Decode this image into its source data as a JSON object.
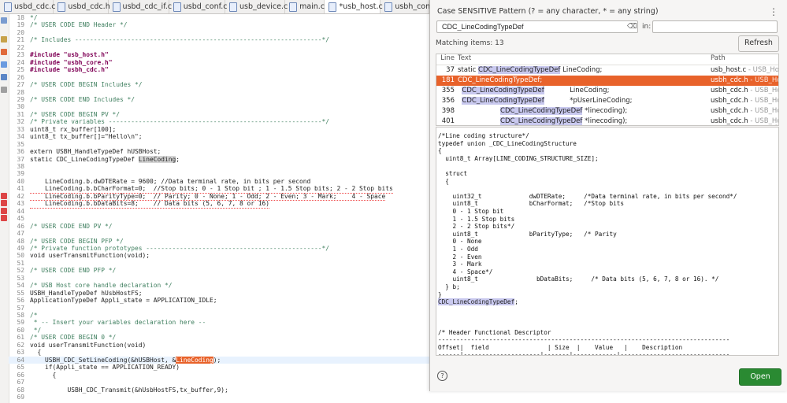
{
  "tabs": [
    {
      "label": "usbd_cdc.c"
    },
    {
      "label": "usbd_cdc.h"
    },
    {
      "label": "usbd_cdc_if.c"
    },
    {
      "label": "usbd_conf.c"
    },
    {
      "label": "usb_device.c"
    },
    {
      "label": "main.c"
    },
    {
      "label": "*usb_host.c"
    },
    {
      "label": "usbh_con"
    }
  ],
  "editor": {
    "lines": [
      {
        "n": "18",
        "t": "*/",
        "cls": "c-comment"
      },
      {
        "n": "19",
        "t": "/* USER CODE END Header */",
        "cls": "c-comment"
      },
      {
        "n": "20",
        "t": ""
      },
      {
        "n": "21",
        "t": "/* Includes ------------------------------------------------------------------*/",
        "cls": "c-comment"
      },
      {
        "n": "22",
        "t": ""
      },
      {
        "n": "23",
        "t": "#include \"usb_host.h\"",
        "cls": "c-pre"
      },
      {
        "n": "24",
        "t": "#include \"usbh_core.h\"",
        "cls": "c-pre"
      },
      {
        "n": "25",
        "t": "#include \"usbh_cdc.h\"",
        "cls": "c-pre"
      },
      {
        "n": "26",
        "t": ""
      },
      {
        "n": "27",
        "t": "/* USER CODE BEGIN Includes */",
        "cls": "c-comment"
      },
      {
        "n": "28",
        "t": ""
      },
      {
        "n": "29",
        "t": "/* USER CODE END Includes */",
        "cls": "c-comment"
      },
      {
        "n": "30",
        "t": ""
      },
      {
        "n": "31",
        "t": "/* USER CODE BEGIN PV */",
        "cls": "c-comment"
      },
      {
        "n": "32",
        "t": "/* Private variables ---------------------------------------------------------*/",
        "cls": "c-comment"
      },
      {
        "n": "33",
        "t": "uint8_t rx_buffer[100];"
      },
      {
        "n": "34",
        "t": "uint8_t tx_buffer[]=\"Hello\\n\";"
      },
      {
        "n": "35",
        "t": ""
      },
      {
        "n": "36",
        "t": "extern USBH_HandleTypeDef hUSBHost;"
      },
      {
        "n": "37",
        "t": "static CDC_LineCodingTypeDef LineCoding;"
      },
      {
        "n": "38",
        "t": ""
      },
      {
        "n": "39",
        "t": ""
      },
      {
        "n": "40",
        "t": "    LineCoding.b.dwDTERate = 9600; //Data terminal rate, in bits per second"
      },
      {
        "n": "41",
        "t": "    LineCoding.b.bCharFormat=0;  //Stop bits; 0 - 1 Stop bit ; 1 - 1.5 Stop bits; 2 - 2 Stop bits"
      },
      {
        "n": "42",
        "t": "    LineCoding.b.bParityType=0;  // Parity; 0 - None; 1 - Odd; 2 - Even; 3 - Mark;    4 - Space"
      },
      {
        "n": "43",
        "t": "    LineCoding.b.bDataBits=8;    // Data bits (5, 6, 7, 8 or 16)"
      },
      {
        "n": "44",
        "t": ""
      },
      {
        "n": "45",
        "t": ""
      },
      {
        "n": "46",
        "t": "/* USER CODE END PV */",
        "cls": "c-comment"
      },
      {
        "n": "47",
        "t": ""
      },
      {
        "n": "48",
        "t": "/* USER CODE BEGIN PFP */",
        "cls": "c-comment"
      },
      {
        "n": "49",
        "t": "/* Private function prototypes -----------------------------------------------*/",
        "cls": "c-comment"
      },
      {
        "n": "50",
        "t": "void userTransmitFunction(void);"
      },
      {
        "n": "51",
        "t": ""
      },
      {
        "n": "52",
        "t": "/* USER CODE END PFP */",
        "cls": "c-comment"
      },
      {
        "n": "53",
        "t": ""
      },
      {
        "n": "54",
        "t": "/* USB Host core handle declaration */",
        "cls": "c-comment"
      },
      {
        "n": "55",
        "t": "USBH_HandleTypeDef hUsbHostFS;"
      },
      {
        "n": "56",
        "t": "ApplicationTypeDef Appli_state = APPLICATION_IDLE;"
      },
      {
        "n": "57",
        "t": ""
      },
      {
        "n": "58",
        "t": "/*",
        "cls": "c-comment"
      },
      {
        "n": "59",
        "t": " * -- Insert your variables declaration here --",
        "cls": "c-comment"
      },
      {
        "n": "60",
        "t": " */",
        "cls": "c-comment"
      },
      {
        "n": "61",
        "t": "/* USER CODE BEGIN 0 */",
        "cls": "c-comment"
      },
      {
        "n": "62",
        "t": "void userTransmitFunction(void)"
      },
      {
        "n": "63",
        "t": "  {"
      },
      {
        "n": "64",
        "t": "    USBH_CDC_SetLineCoding(&hUSBHost, &LineCoding);"
      },
      {
        "n": "65",
        "t": "    if(Appli_state == APPLICATION_READY)"
      },
      {
        "n": "66",
        "t": "      {"
      },
      {
        "n": "67",
        "t": ""
      },
      {
        "n": "68",
        "t": "          USBH_CDC_Transmit(&hUsbHostFS,tx_buffer,9);"
      },
      {
        "n": "69",
        "t": ""
      }
    ]
  },
  "dialog": {
    "pattern_label": "Case SENSITIVE Pattern (? = any character, * = any string)",
    "search_value": "CDC_LineCodingTypeDef",
    "in_label": "in:",
    "in_value": "",
    "matching": "Matching items: 13",
    "refresh_label": "Refresh",
    "columns": {
      "line": "Line",
      "text": "Text",
      "path": "Path"
    },
    "results": [
      {
        "line": "37",
        "pre": "static ",
        "match": "CDC_LineCodingTypeDef",
        "post": " LineCoding;",
        "path": "usb_host.c",
        "path_gray": " - USB_Host_C"
      },
      {
        "line": "181",
        "pre": "",
        "match": "CDC_LineCodingTypeDef",
        "post": ";",
        "path": "usbh_cdc.h",
        "path_gray": " - USB_Host_C",
        "selected": true
      },
      {
        "line": "355",
        "pre": "  ",
        "match": "CDC_LineCodingTypeDef",
        "post": "            LineCoding;",
        "path": "usbh_cdc.h",
        "path_gray": " - USB_Host_C"
      },
      {
        "line": "356",
        "pre": "  ",
        "match": "CDC_LineCodingTypeDef",
        "post": "            *pUserLineCoding;",
        "path": "usbh_cdc.h",
        "path_gray": " - USB_Host_C"
      },
      {
        "line": "398",
        "pre": "                    ",
        "match": "CDC_LineCodingTypeDef",
        "post": " *linecoding);",
        "path": "usbh_cdc.h",
        "path_gray": " - USB_Host_C"
      },
      {
        "line": "401",
        "pre": "                    ",
        "match": "CDC_LineCodingTypeDef",
        "post": " *linecoding);",
        "path": "usbh_cdc.h",
        "path_gray": " - USB_Host_C"
      }
    ],
    "preview_lines": [
      "/*Line coding structure*/",
      "typedef union _CDC_LineCodingStructure",
      "{",
      "  uint8_t Array[LINE_CODING_STRUCTURE_SIZE];",
      "",
      "  struct",
      "  {",
      "",
      "    uint32_t             dwDTERate;     /*Data terminal rate, in bits per second*/",
      "    uint8_t              bCharFormat;   /*Stop bits",
      "    0 - 1 Stop bit",
      "    1 - 1.5 Stop bits",
      "    2 - 2 Stop bits*/",
      "    uint8_t              bParityType;   /* Parity",
      "    0 - None",
      "    1 - Odd",
      "    2 - Even",
      "    3 - Mark",
      "    4 - Space*/",
      "    uint8_t                bDataBits;     /* Data bits (5, 6, 7, 8 or 16). */",
      "  } b;",
      "}",
      "CDC_LineCodingTypeDef;",
      "",
      "",
      "",
      "/* Header Functional Descriptor",
      "--------------------------------------------------------------------------------",
      "Offset|  field                | Size  |    Value   |    Description",
      "------|---------------------|-------|------------|------------------------------"
    ],
    "open_label": "Open",
    "help_glyph": "?"
  }
}
